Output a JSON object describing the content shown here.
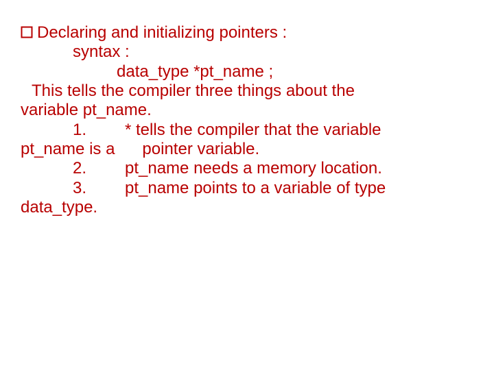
{
  "slide": {
    "title": "Declaring and initializing pointers :",
    "syntax_label": "syntax :",
    "syntax_code": "data_type *pt_name ;",
    "intro_line1": "This tells the compiler three things about the",
    "intro_line2": "variable pt_name.",
    "item1_num": "1.",
    "item1_text": "* tells the compiler that the variable",
    "item1_cont": "pt_name is a      pointer variable.",
    "item2_num": "2.",
    "item2_text": "pt_name needs a memory location.",
    "item3_num": "3.",
    "item3_text": "pt_name points to a variable of type",
    "item3_cont": "data_type."
  }
}
